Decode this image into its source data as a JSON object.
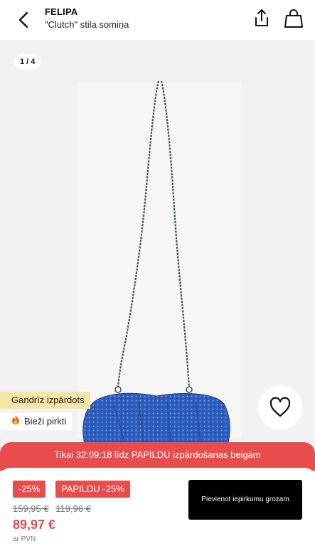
{
  "header": {
    "brand": "FELIPA",
    "product_name": "\"Clutch\" stila somiņa"
  },
  "gallery": {
    "counter": "1 / 4"
  },
  "badges": {
    "sold_out": "Gandrīz izpārdots",
    "popular": "Bieži pirkti"
  },
  "timer": {
    "text": "Tikai 32:09:18 līdz PAPILDU izpārdošanas beigām"
  },
  "buy": {
    "tag_discount": "-25%",
    "tag_extra": "PAPILDU -25%",
    "old_price_1": "159,95 €",
    "old_price_2": "119,96 €",
    "price": "89,97 €",
    "vat": "ar PVN",
    "cart_label": "Pievienot iepirkumu grozam"
  },
  "colors": {
    "accent": "#e84c4c",
    "badge_yellow": "#f5e6a8",
    "bag_blue": "#2f5fbf"
  }
}
